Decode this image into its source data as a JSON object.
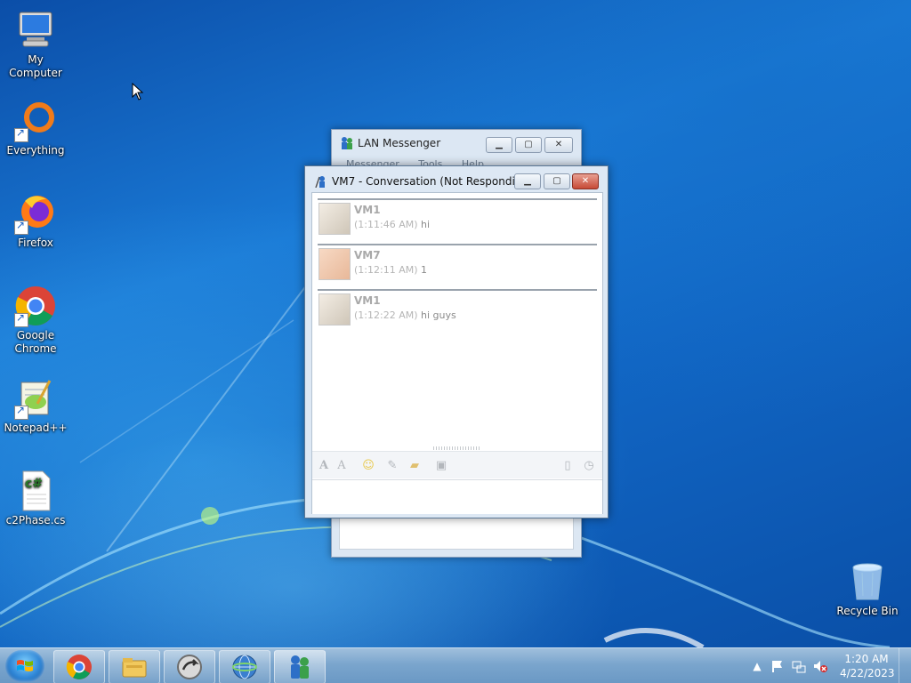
{
  "desktop": {
    "icons": [
      {
        "label": "My Computer",
        "icon": "computer-icon"
      },
      {
        "label": "Everything",
        "icon": "everything-icon"
      },
      {
        "label": "Firefox",
        "icon": "firefox-icon"
      },
      {
        "label": "Google Chrome",
        "icon": "chrome-icon"
      },
      {
        "label": "Notepad++",
        "icon": "notepadpp-icon"
      },
      {
        "label": "c2Phase.cs",
        "icon": "csharp-file-icon"
      },
      {
        "label": "Recycle Bin",
        "icon": "recycle-bin-icon"
      }
    ]
  },
  "lan_window": {
    "title": "LAN Messenger",
    "menu": [
      "Messenger",
      "Tools",
      "Help"
    ]
  },
  "conversation": {
    "title": "VM7 - Conversation (Not Respondin...",
    "messages": [
      {
        "sender": "VM1",
        "time": "(1:11:46 AM)",
        "text": "hi"
      },
      {
        "sender": "VM7",
        "time": "(1:12:11 AM)",
        "text": "1"
      },
      {
        "sender": "VM1",
        "time": "(1:12:22 AM)",
        "text": "hi guys"
      }
    ],
    "toolbar": [
      "font-icon",
      "font-color-icon",
      "smiley-icon",
      "attach-file-icon",
      "send-folder-icon",
      "save-icon",
      "clear-icon",
      "history-icon"
    ]
  },
  "taskbar": {
    "pinned": [
      "chrome-icon",
      "explorer-icon",
      "app-arrow-icon",
      "network-globe-icon",
      "lan-messenger-icon"
    ],
    "clock_time": "1:20 AM",
    "clock_date": "4/22/2023"
  },
  "colors": {
    "desktop_blue": "#1a7ad6",
    "taskbar": "#7aa5cd",
    "close_red": "#c74a36"
  }
}
